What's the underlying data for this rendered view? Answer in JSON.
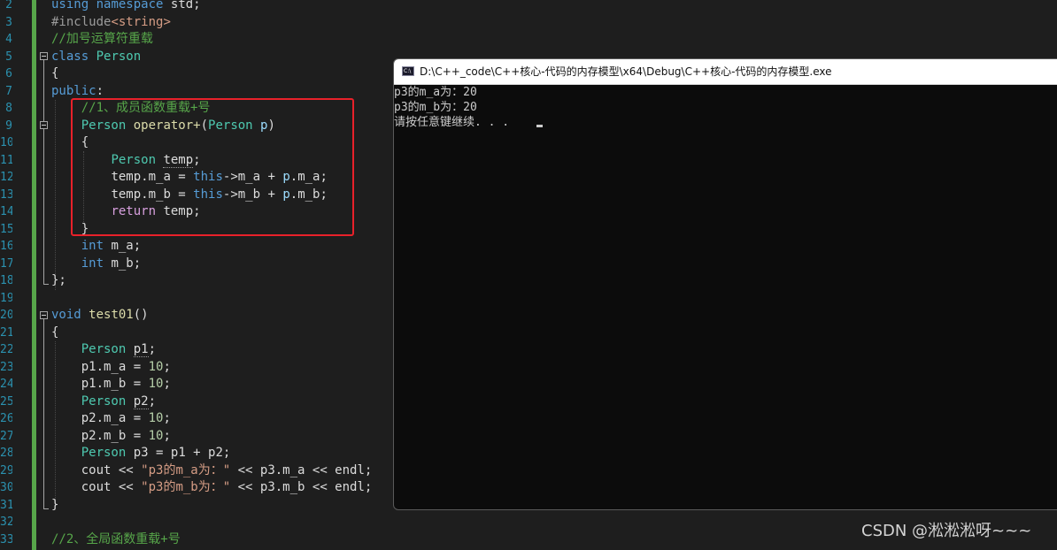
{
  "gutter": {
    "line_numbers": [
      "2",
      "3",
      "4",
      "5",
      "6",
      "7",
      "8",
      "9",
      "10",
      "11",
      "12",
      "13",
      "14",
      "15",
      "16",
      "17",
      "18",
      "19",
      "20",
      "21",
      "22",
      "23",
      "24",
      "25",
      "26",
      "27",
      "28",
      "29",
      "30",
      "31",
      "32",
      "33"
    ]
  },
  "code": {
    "l2": {
      "kw_using": "using",
      "kw_namespace": "namespace",
      "ns": "std;"
    },
    "l3": {
      "directive": "#include",
      "header": "<string>"
    },
    "l4": {
      "comment": "//加号运算符重载"
    },
    "l5": {
      "kw_class": "class",
      "class_name": "Person"
    },
    "l6": {
      "brace": "{"
    },
    "l7": {
      "kw_public": "public",
      "colon": ":"
    },
    "l8": {
      "comment": "//1、成员函数重载+号"
    },
    "l9": {
      "type": "Person",
      "fn": "operator+",
      "open": "(",
      "ptype": "Person",
      "pname": "p",
      "close": ")"
    },
    "l10": {
      "brace": "{"
    },
    "l11": {
      "type": "Person",
      "var": "temp",
      "semi": ";"
    },
    "l12": {
      "var": "temp",
      "member": ".m_a",
      "eq": " = ",
      "kw_this": "this",
      "arrow": "->m_a + ",
      "pvar": "p",
      "pmember": ".m_a;"
    },
    "l13": {
      "var": "temp",
      "member": ".m_b",
      "eq": " = ",
      "kw_this": "this",
      "arrow": "->m_b + ",
      "pvar": "p",
      "pmember": ".m_b;"
    },
    "l14": {
      "kw_return": "return",
      "var": "temp",
      "semi": ";"
    },
    "l15": {
      "brace": "}"
    },
    "l16": {
      "kw_int": "int",
      "rest": "m_a;"
    },
    "l17": {
      "kw_int": "int",
      "rest": "m_b;"
    },
    "l18": {
      "brace": "};"
    },
    "l20": {
      "kw_void": "void",
      "fn": "test01",
      "parens": "()"
    },
    "l21": {
      "brace": "{"
    },
    "l22": {
      "type": "Person",
      "var": "p1",
      "semi": ";"
    },
    "l23": {
      "var": "p1",
      "rest": ".m_a = ",
      "num": "10",
      "semi": ";"
    },
    "l24": {
      "var": "p1",
      "rest": ".m_b = ",
      "num": "10",
      "semi": ";"
    },
    "l25": {
      "type": "Person",
      "var": "p2",
      "semi": ";"
    },
    "l26": {
      "var": "p2",
      "rest": ".m_a = ",
      "num": "10",
      "semi": ";"
    },
    "l27": {
      "var": "p2",
      "rest": ".m_b = ",
      "num": "10",
      "semi": ";"
    },
    "l28": {
      "type": "Person",
      "var": "p3",
      "eq": " = ",
      "a": "p1",
      "plus": " + ",
      "b": "p2",
      "semi": ";"
    },
    "l29": {
      "cout": "cout << ",
      "str": "\"p3的m_a为：\"",
      "op": " << ",
      "var": "p3",
      "member": ".m_a << endl;"
    },
    "l30": {
      "cout": "cout << ",
      "str": "\"p3的m_b为：\"",
      "op": " << ",
      "var": "p3",
      "member": ".m_b << endl;"
    },
    "l31": {
      "brace": "}"
    },
    "l33": {
      "comment": "//2、全局函数重载+号"
    }
  },
  "console": {
    "icon_text": "C:\\",
    "title": "D:\\C++_code\\C++核心-代码的内存模型\\x64\\Debug\\C++核心-代码的内存模型.exe",
    "lines": [
      "p3的m_a为：20",
      "p3的m_b为：20",
      "请按任意键继续. . ."
    ]
  },
  "watermark": "CSDN @淞淞淞呀~~~",
  "colors": {
    "editor_bg": "#1e1e1e",
    "highlight_box": "#e8212a",
    "console_bg": "#0c0c0c",
    "change_bar": "#57a64a"
  }
}
